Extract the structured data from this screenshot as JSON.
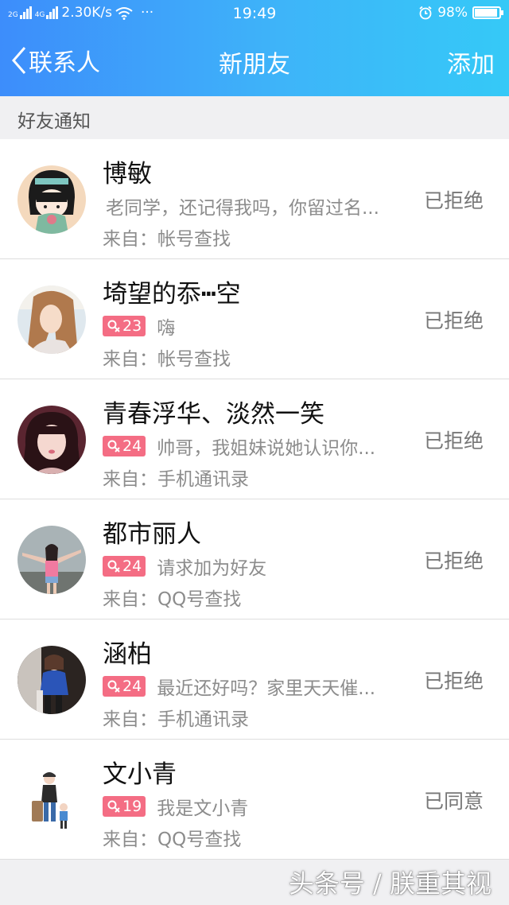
{
  "status_bar": {
    "network_2g": "2G",
    "network_4g": "4G",
    "speed": "2.30K/s",
    "more": "···",
    "time": "19:49",
    "battery": "98%",
    "icons": [
      "signal-icon",
      "wifi-icon",
      "alarm-icon",
      "battery-icon"
    ]
  },
  "nav": {
    "back_label": "联系人",
    "title": "新朋友",
    "add_label": "添加"
  },
  "section": {
    "title": "好友通知"
  },
  "requests": [
    {
      "name": "博敏",
      "age": null,
      "message": "老同学，还记得我吗，你留过名...",
      "source": "来自：帐号查找",
      "status": "已拒绝"
    },
    {
      "name": "埼望的忝┅空",
      "age": "23",
      "message": "嗨",
      "source": "来自：帐号查找",
      "status": "已拒绝"
    },
    {
      "name": "青春浮华、淡然一笑",
      "age": "24",
      "message": "帅哥，我姐妹说她认识你...",
      "source": "来自：手机通讯录",
      "status": "已拒绝"
    },
    {
      "name": "都市丽人",
      "age": "24",
      "message": "请求加为好友",
      "source": "来自：QQ号查找",
      "status": "已拒绝"
    },
    {
      "name": "涵柏",
      "age": "24",
      "message": "最近还好吗？家里天天催...",
      "source": "来自：手机通讯录",
      "status": "已拒绝"
    },
    {
      "name": "文小青",
      "age": "19",
      "message": "我是文小青",
      "source": "来自：QQ号查找",
      "status": "已同意"
    }
  ],
  "watermark": "头条号 / 朕重其视",
  "colors": {
    "header_start": "#3d8dfb",
    "header_end": "#35c9f7",
    "tag_female": "#f46d84",
    "status_text": "#777777"
  }
}
